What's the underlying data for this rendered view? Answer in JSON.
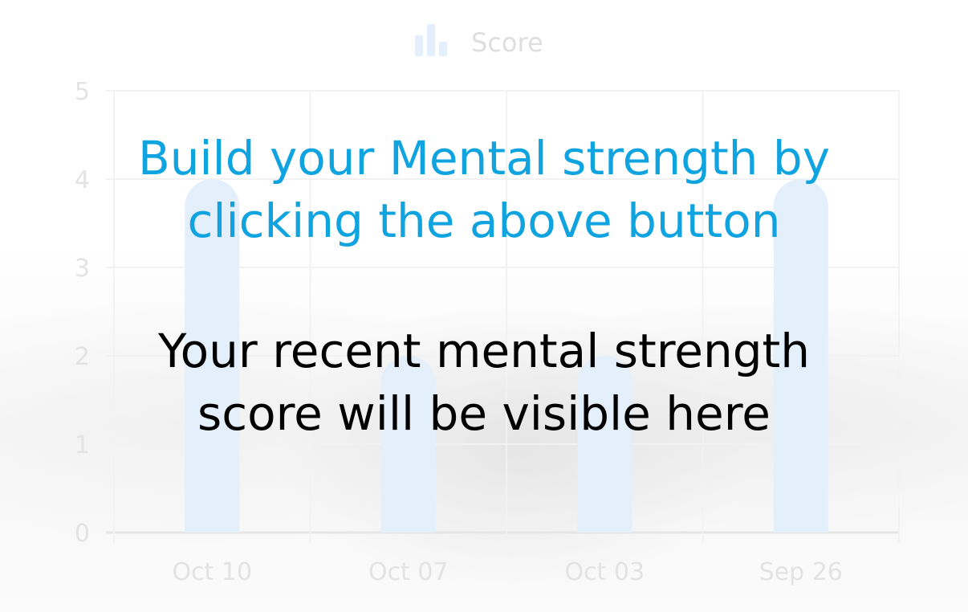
{
  "chart_data": {
    "type": "bar",
    "categories": [
      "Oct 10",
      "Oct 07",
      "Oct 03",
      "Sep 26"
    ],
    "series": [
      {
        "name": "Score",
        "values": [
          4,
          2,
          2,
          4
        ]
      }
    ],
    "ylim": [
      0,
      5
    ],
    "y_ticks": [
      "0",
      "1",
      "2",
      "3",
      "4",
      "5"
    ],
    "grid": true,
    "legend": "top-center",
    "colors": {
      "bar": "#e3effb",
      "legend_icon": "#e3effb",
      "grid": "#f2f2f2",
      "axis": "#e6e6e6"
    },
    "legend_icon": "bar-chart-icon"
  },
  "overlay": {
    "cta_line1": "Build your Mental strength by",
    "cta_line2": "clicking the above button",
    "info_line1": "Your recent mental strength",
    "info_line2": "score will be visible here",
    "cta_color": "#0fa3e0"
  }
}
